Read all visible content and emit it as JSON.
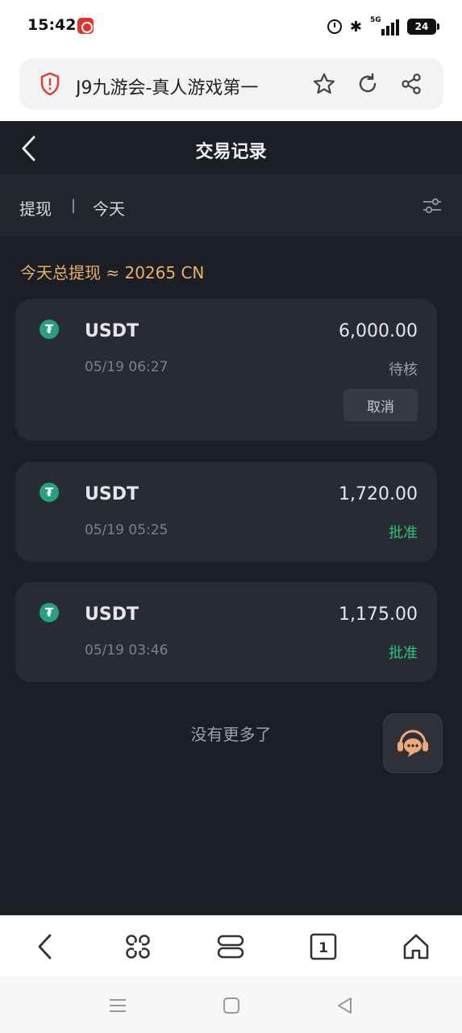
{
  "status_bar": {
    "time": "15:42",
    "battery": "24",
    "network": "5G"
  },
  "browser": {
    "url_title": "J9九游会-真人游戏第一"
  },
  "header": {
    "title": "交易记录"
  },
  "filter": {
    "type": "提现",
    "separator": "|",
    "date": "今天"
  },
  "summary": "今天总提现 ≈ 20265 CN",
  "transactions": [
    {
      "currency": "USDT",
      "amount": "6,000.00",
      "time": "05/19 06:27",
      "status": "待核",
      "status_kind": "pending",
      "action": "取消"
    },
    {
      "currency": "USDT",
      "amount": "1,720.00",
      "time": "05/19 05:25",
      "status": "批准",
      "status_kind": "approved"
    },
    {
      "currency": "USDT",
      "amount": "1,175.00",
      "time": "05/19 03:46",
      "status": "批准",
      "status_kind": "approved"
    }
  ],
  "coin_symbol": "₮",
  "no_more": "没有更多了",
  "tab_count": "1",
  "colors": {
    "accent": "#e9b16c",
    "approved": "#2cc27b",
    "coin": "#26a17b",
    "background": "#1c1e26",
    "card": "#292b34"
  },
  "icons": [
    "shield-icon",
    "star-icon",
    "refresh-icon",
    "share-icon",
    "back-icon",
    "filter-icon",
    "tether-icon",
    "support-headset-icon",
    "apps-icon",
    "tabs-stack-icon",
    "home-icon"
  ]
}
